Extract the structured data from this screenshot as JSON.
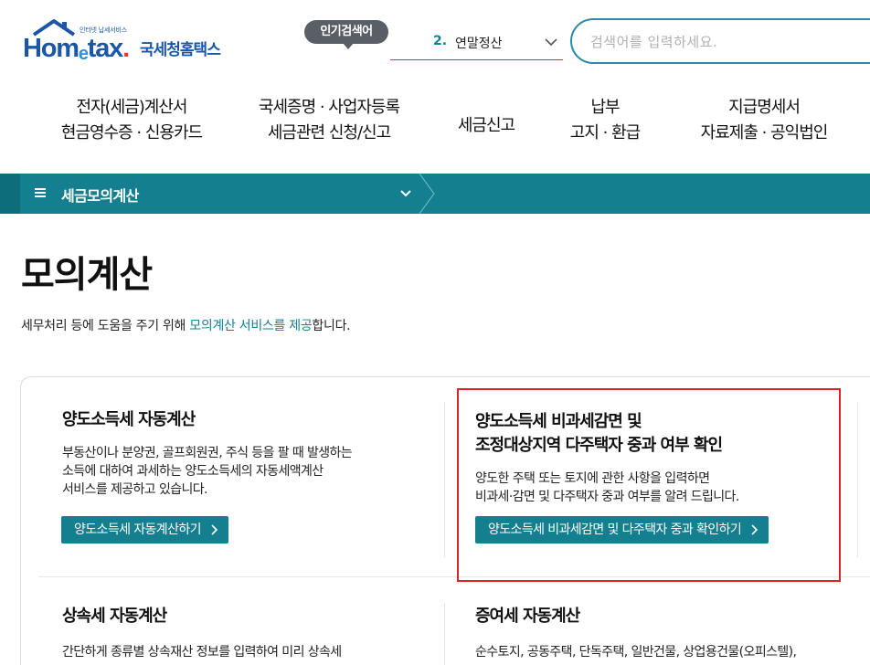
{
  "header": {
    "logo_tagline": "인터넷 납세서비스",
    "logo_en_pre": "Hom",
    "logo_en_e": "e",
    "logo_en_post": "tax",
    "logo_en_dot": ".",
    "logo_ko": "국세청홈택스",
    "popular_badge": "인기검색어",
    "popular_rank": "2.",
    "popular_term": "연말정산",
    "search_placeholder": "검색어를 입력하세요."
  },
  "gnb": [
    {
      "line1": "전자(세금)계산서",
      "line2": "현금영수증 · 신용카드"
    },
    {
      "line1": "국세증명 · 사업자등록",
      "line2": "세금관련 신청/신고"
    },
    {
      "line1": "세금신고",
      "line2": ""
    },
    {
      "line1": "납부",
      "line2": "고지 · 환급"
    },
    {
      "line1": "지급명세서",
      "line2": "자료제출 · 공익법인"
    }
  ],
  "subnav": {
    "title": "세금모의계산"
  },
  "page": {
    "title": "모의계산",
    "desc_pre": "세무처리 등에 도움을 주기 위해 ",
    "desc_highlight": "모의계산 서비스를 제공",
    "desc_post": "합니다."
  },
  "cards": {
    "transfer_tax": {
      "title": "양도소득세 자동계산",
      "desc1": "부동산이나 분양권, 골프회원권, 주식 등을 팔 때 발생하는",
      "desc2": "소득에 대하여 과세하는 양도소득세의 자동세액계산",
      "desc3": "서비스를 제공하고 있습니다.",
      "button": "양도소득세 자동계산하기"
    },
    "transfer_exempt": {
      "title1": "양도소득세 비과세감면 및",
      "title2": "조정대상지역 다주택자 중과 여부 확인",
      "desc1": "양도한 주택 또는 토지에 관한 사항을 입력하면",
      "desc2": "비과세·감면 및 다주택자 중과 여부를 알려 드립니다.",
      "button": "양도소득세 비과세감면 및 다주택자 중과 확인하기"
    },
    "inheritance_tax": {
      "title": "상속세 자동계산",
      "desc1": "간단하게 종류별 상속재산 정보를 입력하여 미리 상속세"
    },
    "gift_tax": {
      "title": "증여세 자동계산",
      "desc1": "순수토지, 공동주택, 단독주택, 일반건물, 상업용건물(오피스텔),"
    }
  },
  "colors": {
    "brand_teal": "#137f8f",
    "logo_blue": "#1b57a6",
    "highlight_red": "#e02424",
    "badge_gray": "#5a5f66"
  },
  "icons": [
    "house-roof-icon",
    "chevron-down-icon",
    "hamburger-menu-icon",
    "chevron-right-icon"
  ]
}
